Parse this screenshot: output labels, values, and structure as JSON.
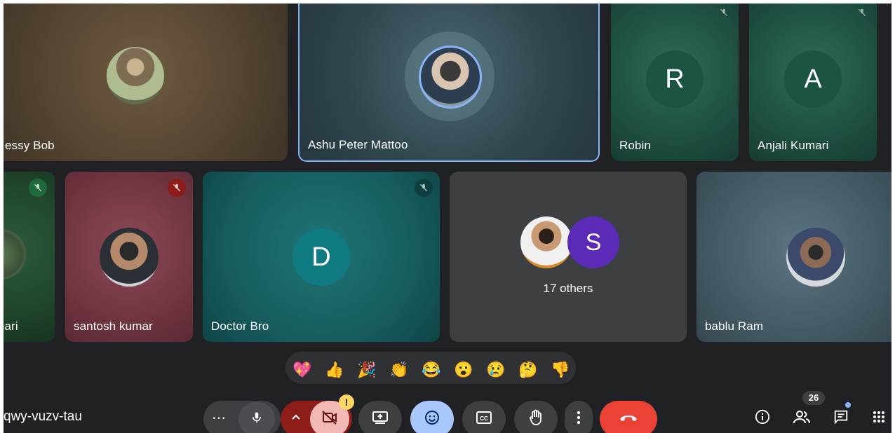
{
  "participants": {
    "jessy": {
      "name": "essy Bob"
    },
    "ashu": {
      "name": "Ashu Peter Mattoo"
    },
    "robin": {
      "name": "Robin",
      "initial": "R"
    },
    "anjali": {
      "name": "Anjali Kumari",
      "initial": "A"
    },
    "partial": {
      "name": "nari"
    },
    "santosh": {
      "name": "santosh kumar"
    },
    "doctor": {
      "name": "Doctor Bro",
      "initial": "D"
    },
    "others": {
      "label": "17 others",
      "initial": "S"
    },
    "bablu": {
      "name": "bablu Ram"
    }
  },
  "reactions": [
    "💖",
    "👍",
    "🎉",
    "👏",
    "😂",
    "😮",
    "😢",
    "🤔",
    "👎"
  ],
  "meeting": {
    "code": "qwy-vuzv-tau"
  },
  "controls": {
    "more_left": "⋯",
    "camera_warning": "!",
    "people_count": "26"
  },
  "icons": {
    "mic": "mic-icon",
    "camera_off": "camera-off-icon",
    "present": "present-icon",
    "emoji": "emoji-icon",
    "captions": "captions-icon",
    "raise_hand": "raise-hand-icon",
    "more": "more-vert-icon",
    "end_call": "end-call-icon",
    "info": "info-icon",
    "people": "people-icon",
    "chat": "chat-icon",
    "apps": "apps-icon"
  },
  "colors": {
    "stage": "#202124",
    "end_call": "#ea4335",
    "active_speaker": "#8ab4f8",
    "emoji_active": "#a8c7fa",
    "camera_off_bg": "#f2b8b5",
    "muted_red": "#8c1d18"
  }
}
